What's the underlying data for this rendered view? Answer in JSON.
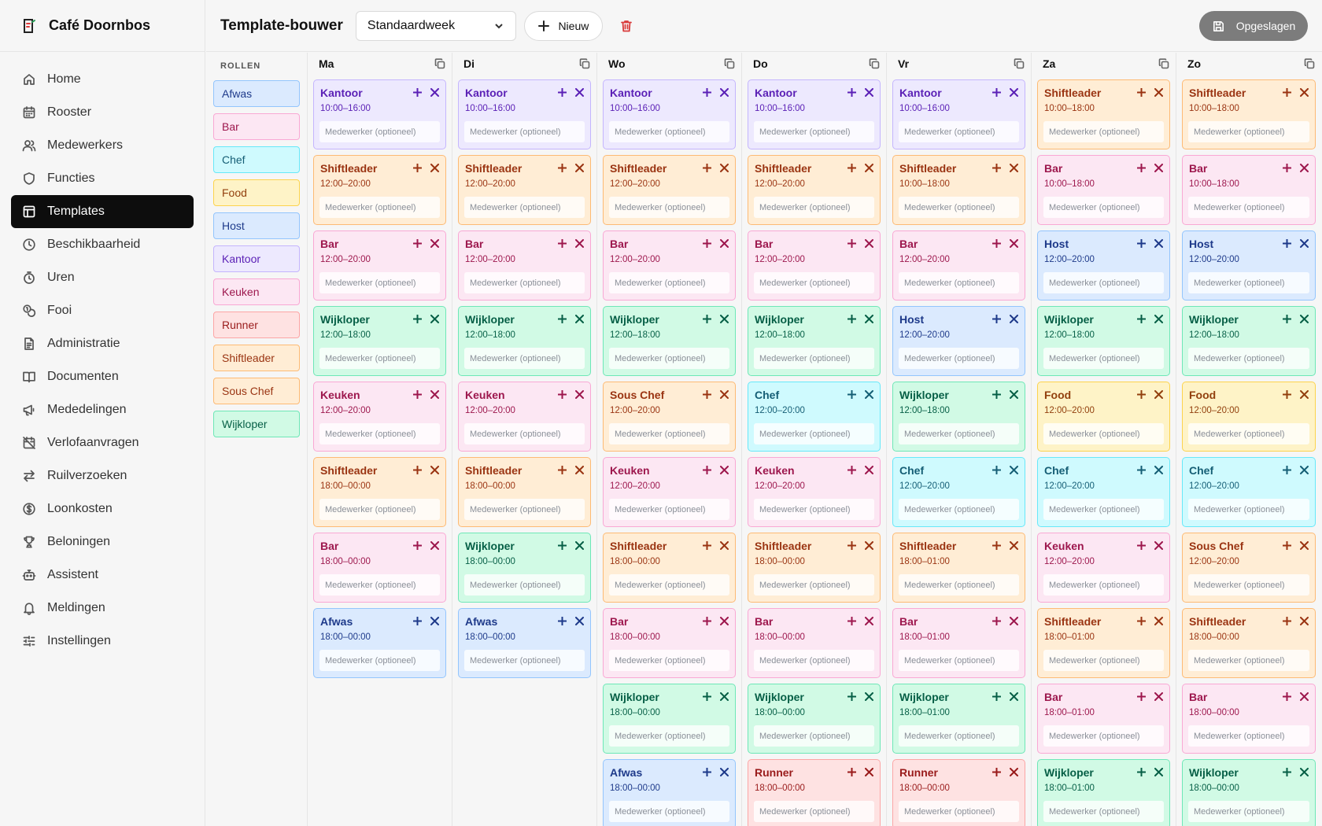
{
  "brand": {
    "name": "Café Doornbos"
  },
  "sidebar": {
    "items": [
      {
        "label": "Home",
        "icon": "home-icon",
        "active": false
      },
      {
        "label": "Rooster",
        "icon": "calendar-icon",
        "active": false
      },
      {
        "label": "Medewerkers",
        "icon": "users-icon",
        "active": false
      },
      {
        "label": "Functies",
        "icon": "shield-icon",
        "active": false
      },
      {
        "label": "Templates",
        "icon": "layout-icon",
        "active": true
      },
      {
        "label": "Beschikbaarheid",
        "icon": "clock-icon",
        "active": false
      },
      {
        "label": "Uren",
        "icon": "timer-icon",
        "active": false
      },
      {
        "label": "Fooi",
        "icon": "coins-icon",
        "active": false
      },
      {
        "label": "Administratie",
        "icon": "file-text-icon",
        "active": false
      },
      {
        "label": "Documenten",
        "icon": "book-icon",
        "active": false
      },
      {
        "label": "Mededelingen",
        "icon": "megaphone-icon",
        "active": false
      },
      {
        "label": "Verlofaanvragen",
        "icon": "calendar-off-icon",
        "active": false
      },
      {
        "label": "Ruilverzoeken",
        "icon": "swap-icon",
        "active": false
      },
      {
        "label": "Loonkosten",
        "icon": "dollar-circle-icon",
        "active": false
      },
      {
        "label": "Beloningen",
        "icon": "trophy-icon",
        "active": false
      },
      {
        "label": "Assistent",
        "icon": "bot-icon",
        "active": false
      },
      {
        "label": "Meldingen",
        "icon": "bell-icon",
        "active": false
      },
      {
        "label": "Instellingen",
        "icon": "sliders-icon",
        "active": false
      }
    ]
  },
  "header": {
    "title": "Template-bouwer",
    "template_select": "Standaardweek",
    "new_label": "Nieuw",
    "saved_label": "Opgeslagen"
  },
  "roles": {
    "title": "ROLLEN",
    "items": [
      "Afwas",
      "Bar",
      "Chef",
      "Food",
      "Host",
      "Kantoor",
      "Keuken",
      "Runner",
      "Shiftleader",
      "Sous Chef",
      "Wijkloper"
    ]
  },
  "role_colors": {
    "Afwas": {
      "bg": "#dbeafe",
      "border": "#93c5fd",
      "text": "#1e3a8a"
    },
    "Bar": {
      "bg": "#fce7f3",
      "border": "#f9a8d4",
      "text": "#9d174d"
    },
    "Chef": {
      "bg": "#cffafe",
      "border": "#67e8f9",
      "text": "#155e75"
    },
    "Food": {
      "bg": "#fef3c7",
      "border": "#fcd34d",
      "text": "#92400e"
    },
    "Host": {
      "bg": "#dbeafe",
      "border": "#93c5fd",
      "text": "#1e3a8a"
    },
    "Kantoor": {
      "bg": "#ede9fe",
      "border": "#c4b5fd",
      "text": "#5b21b6"
    },
    "Keuken": {
      "bg": "#fce7f3",
      "border": "#f9a8d4",
      "text": "#9d174d"
    },
    "Runner": {
      "bg": "#fee2e2",
      "border": "#fca5a5",
      "text": "#991b1b"
    },
    "Shiftleader": {
      "bg": "#ffedd5",
      "border": "#fdba74",
      "text": "#9a3412"
    },
    "Sous Chef": {
      "bg": "#ffedd5",
      "border": "#fdba74",
      "text": "#9a3412"
    },
    "Wijkloper": {
      "bg": "#d1fae5",
      "border": "#6ee7b7",
      "text": "#065f46"
    }
  },
  "shift_placeholder": "Medewerker (optioneel)",
  "days": [
    {
      "name": "Ma",
      "shifts": [
        {
          "role": "Kantoor",
          "time": "10:00–16:00"
        },
        {
          "role": "Shiftleader",
          "time": "12:00–20:00"
        },
        {
          "role": "Bar",
          "time": "12:00–20:00"
        },
        {
          "role": "Wijkloper",
          "time": "12:00–18:00"
        },
        {
          "role": "Keuken",
          "time": "12:00–20:00"
        },
        {
          "role": "Shiftleader",
          "time": "18:00–00:00"
        },
        {
          "role": "Bar",
          "time": "18:00–00:00"
        },
        {
          "role": "Afwas",
          "time": "18:00–00:00"
        }
      ]
    },
    {
      "name": "Di",
      "shifts": [
        {
          "role": "Kantoor",
          "time": "10:00–16:00"
        },
        {
          "role": "Shiftleader",
          "time": "12:00–20:00"
        },
        {
          "role": "Bar",
          "time": "12:00–20:00"
        },
        {
          "role": "Wijkloper",
          "time": "12:00–18:00"
        },
        {
          "role": "Keuken",
          "time": "12:00–20:00"
        },
        {
          "role": "Shiftleader",
          "time": "18:00–00:00"
        },
        {
          "role": "Wijkloper",
          "time": "18:00–00:00"
        },
        {
          "role": "Afwas",
          "time": "18:00–00:00"
        }
      ]
    },
    {
      "name": "Wo",
      "shifts": [
        {
          "role": "Kantoor",
          "time": "10:00–16:00"
        },
        {
          "role": "Shiftleader",
          "time": "12:00–20:00"
        },
        {
          "role": "Bar",
          "time": "12:00–20:00"
        },
        {
          "role": "Wijkloper",
          "time": "12:00–18:00"
        },
        {
          "role": "Sous Chef",
          "time": "12:00–20:00"
        },
        {
          "role": "Keuken",
          "time": "12:00–20:00"
        },
        {
          "role": "Shiftleader",
          "time": "18:00–00:00"
        },
        {
          "role": "Bar",
          "time": "18:00–00:00"
        },
        {
          "role": "Wijkloper",
          "time": "18:00–00:00"
        },
        {
          "role": "Afwas",
          "time": "18:00–00:00"
        }
      ]
    },
    {
      "name": "Do",
      "shifts": [
        {
          "role": "Kantoor",
          "time": "10:00–16:00"
        },
        {
          "role": "Shiftleader",
          "time": "12:00–20:00"
        },
        {
          "role": "Bar",
          "time": "12:00–20:00"
        },
        {
          "role": "Wijkloper",
          "time": "12:00–18:00"
        },
        {
          "role": "Chef",
          "time": "12:00–20:00"
        },
        {
          "role": "Keuken",
          "time": "12:00–20:00"
        },
        {
          "role": "Shiftleader",
          "time": "18:00–00:00"
        },
        {
          "role": "Bar",
          "time": "18:00–00:00"
        },
        {
          "role": "Wijkloper",
          "time": "18:00–00:00"
        },
        {
          "role": "Runner",
          "time": "18:00–00:00"
        }
      ]
    },
    {
      "name": "Vr",
      "shifts": [
        {
          "role": "Kantoor",
          "time": "10:00–16:00"
        },
        {
          "role": "Shiftleader",
          "time": "10:00–18:00"
        },
        {
          "role": "Bar",
          "time": "12:00–20:00"
        },
        {
          "role": "Host",
          "time": "12:00–20:00"
        },
        {
          "role": "Wijkloper",
          "time": "12:00–18:00"
        },
        {
          "role": "Chef",
          "time": "12:00–20:00"
        },
        {
          "role": "Shiftleader",
          "time": "18:00–01:00"
        },
        {
          "role": "Bar",
          "time": "18:00–01:00"
        },
        {
          "role": "Wijkloper",
          "time": "18:00–01:00"
        },
        {
          "role": "Runner",
          "time": "18:00–00:00"
        }
      ]
    },
    {
      "name": "Za",
      "shifts": [
        {
          "role": "Shiftleader",
          "time": "10:00–18:00"
        },
        {
          "role": "Bar",
          "time": "10:00–18:00"
        },
        {
          "role": "Host",
          "time": "12:00–20:00"
        },
        {
          "role": "Wijkloper",
          "time": "12:00–18:00"
        },
        {
          "role": "Food",
          "time": "12:00–20:00"
        },
        {
          "role": "Chef",
          "time": "12:00–20:00"
        },
        {
          "role": "Keuken",
          "time": "12:00–20:00"
        },
        {
          "role": "Shiftleader",
          "time": "18:00–01:00"
        },
        {
          "role": "Bar",
          "time": "18:00–01:00"
        },
        {
          "role": "Wijkloper",
          "time": "18:00–01:00"
        }
      ]
    },
    {
      "name": "Zo",
      "shifts": [
        {
          "role": "Shiftleader",
          "time": "10:00–18:00"
        },
        {
          "role": "Bar",
          "time": "10:00–18:00"
        },
        {
          "role": "Host",
          "time": "12:00–20:00"
        },
        {
          "role": "Wijkloper",
          "time": "12:00–18:00"
        },
        {
          "role": "Food",
          "time": "12:00–20:00"
        },
        {
          "role": "Chef",
          "time": "12:00–20:00"
        },
        {
          "role": "Sous Chef",
          "time": "12:00–20:00"
        },
        {
          "role": "Shiftleader",
          "time": "18:00–00:00"
        },
        {
          "role": "Bar",
          "time": "18:00–00:00"
        },
        {
          "role": "Wijkloper",
          "time": "18:00–00:00"
        }
      ]
    }
  ]
}
